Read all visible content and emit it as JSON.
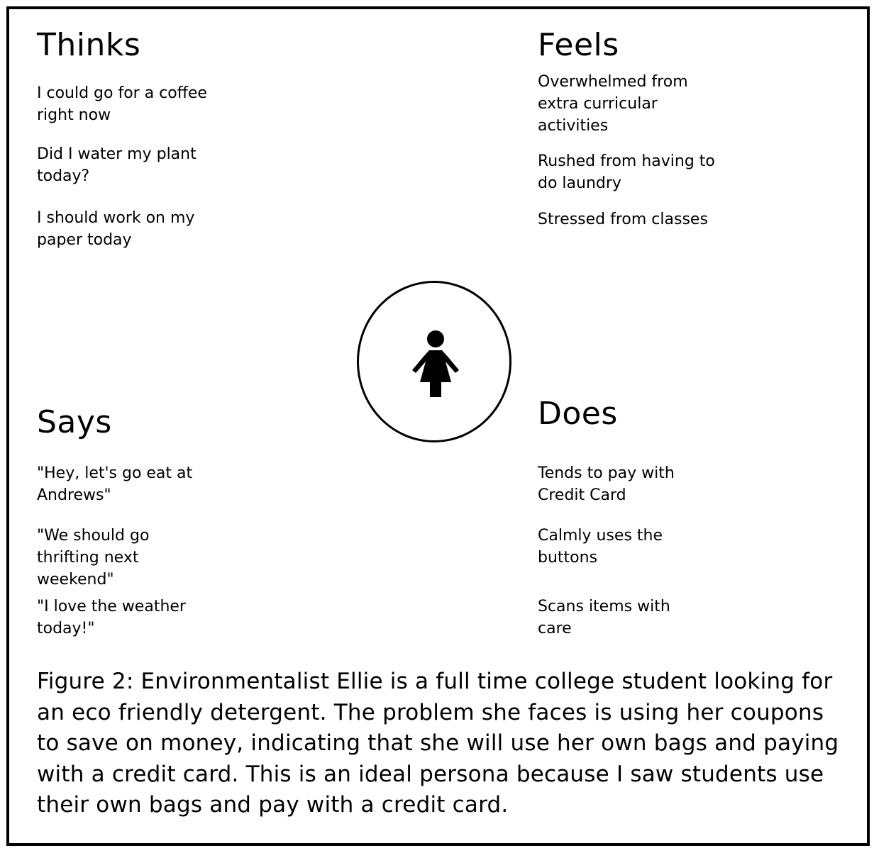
{
  "thinks": {
    "heading": "Thinks",
    "items": [
      "I could go for a coffee right now",
      "Did I water my plant today?",
      "I should work on my paper today"
    ]
  },
  "feels": {
    "heading": "Feels",
    "items": [
      "Overwhelmed from extra curricular activities",
      "Rushed from having to do laundry",
      "Stressed from classes"
    ]
  },
  "says": {
    "heading": "Says",
    "items": [
      "\"Hey, let's go eat at Andrews\"",
      "\"We should go thrifting next weekend\"",
      "\"I love the weather today!\""
    ]
  },
  "does": {
    "heading": "Does",
    "items": [
      "Tends to pay with Credit Card",
      "Calmly uses the buttons",
      "Scans items with care"
    ]
  },
  "center": {
    "icon": "woman-icon"
  },
  "caption": "Figure 2:  Environmentalist Ellie is a full time college student looking for an eco friendly detergent. The problem she faces is using her coupons to save on money, indicating that she will use her own bags and paying with a credit card. This is an ideal persona because I saw students use their own bags and pay with a credit card."
}
